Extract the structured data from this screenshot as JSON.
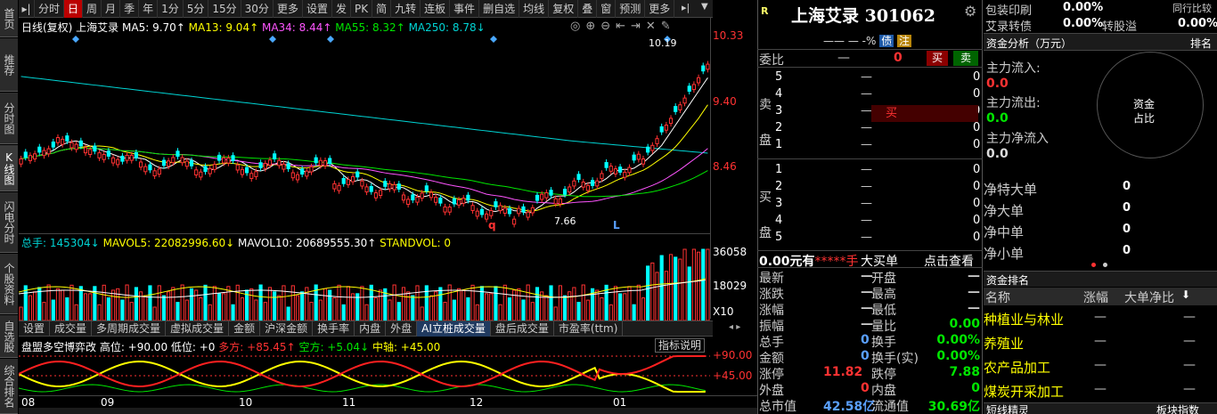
{
  "left_tabs": [
    "首页",
    "推荐",
    "分时图",
    "K线图",
    "闪电分时",
    "个股资料",
    "自选股",
    "综合排名"
  ],
  "toolbar": {
    "items": [
      "分时",
      "日",
      "周",
      "月",
      "季",
      "年",
      "1分",
      "5分",
      "15分",
      "30分",
      "更多",
      "设置",
      "发",
      "PK",
      "简",
      "九转",
      "连板",
      "事件",
      "删自选",
      "均线",
      "复权",
      "叠",
      "窗",
      "预测",
      "更多"
    ],
    "active": "日"
  },
  "chart_info": {
    "prefix": "日线(复权) 上海艾录",
    "ma5": "MA5: 9.70↑",
    "ma13": "MA13: 9.04↑",
    "ma34": "MA34: 8.44↑",
    "ma55": "MA55: 8.32↑",
    "ma250": "MA250: 8.78↓"
  },
  "price_axis": [
    "10.33",
    "9.40",
    "8.46"
  ],
  "annotations": {
    "high": "10.19",
    "low": "7.66",
    "q": "q",
    "l": "L"
  },
  "volume_info": {
    "total": "总手: 145304↓",
    "mavol5": "MAVOL5: 22082996.60↓",
    "mavol10": "MAVOL10: 20689555.30↑",
    "stand": "STANDVOL: 0"
  },
  "volume_axis": [
    "36058",
    "18029",
    "X10"
  ],
  "bottom_tabs": [
    "设置",
    "成交量",
    "多周期成交量",
    "虚拟成交量",
    "金额",
    "沪深金额",
    "换手率",
    "内盘",
    "外盘",
    "AI立桩成交量",
    "盘后成交量",
    "市盈率(ttm)"
  ],
  "bottom_active": "AI立桩成交量",
  "indicator": {
    "title": "盘盟多空博弈改 高位: +90.00 低位: +0",
    "duo": "多方: +85.45↑",
    "kong": "空方: +5.04↓",
    "mid": "中轴: +45.00",
    "help": "指标说明",
    "axis_hi": "+90.00",
    "axis_mid": "+45.00"
  },
  "x_axis": [
    "08",
    "09",
    "10",
    "11",
    "12",
    "01"
  ],
  "quote": {
    "r_badge": "R",
    "title": "上海艾录 301062",
    "sub": "—— — -% ",
    "badge_zhai": "债",
    "badge_zhu": "注",
    "weibi_label": "委比",
    "weibi_val": "—",
    "weibi_num": "0",
    "buy_btn": "买",
    "sell_btn": "卖",
    "sell_label": "卖盘",
    "buy_label": "买盘",
    "sell_levels": [
      {
        "n": "5",
        "p": "—",
        "v": "0"
      },
      {
        "n": "4",
        "p": "—",
        "v": "0"
      },
      {
        "n": "3",
        "p": "—",
        "v": "0"
      },
      {
        "n": "2",
        "p": "—",
        "v": "0"
      },
      {
        "n": "1",
        "p": "—",
        "v": "0"
      }
    ],
    "buy_levels": [
      {
        "n": "1",
        "p": "—",
        "v": "0"
      },
      {
        "n": "2",
        "p": "—",
        "v": "0"
      },
      {
        "n": "3",
        "p": "—",
        "v": "0"
      },
      {
        "n": "4",
        "p": "—",
        "v": "0"
      },
      {
        "n": "5",
        "p": "—",
        "v": "0"
      }
    ],
    "mid_buy_tag": "买",
    "amount_line": "0.00元有",
    "stars": "*****手",
    "big_buy": "大买单",
    "click_view": "点击查看",
    "stats": [
      {
        "l": "最新",
        "v": "—",
        "l2": "开盘",
        "v2": "—"
      },
      {
        "l": "涨跌",
        "v": "—",
        "l2": "最高",
        "v2": "—"
      },
      {
        "l": "涨幅",
        "v": "—",
        "l2": "最低",
        "v2": "—"
      },
      {
        "l": "振幅",
        "v": "—",
        "l2": "量比",
        "v2": "0.00"
      },
      {
        "l": "总手",
        "v": "0",
        "l2": "换手",
        "v2": "0.00%"
      },
      {
        "l": "金额",
        "v": "0",
        "l2": "换手(实)",
        "v2": "0.00%"
      },
      {
        "l": "涨停",
        "v": "11.82",
        "l2": "跌停",
        "v2": "7.88"
      },
      {
        "l": "外盘",
        "v": "0",
        "l2": "内盘",
        "v2": "0"
      },
      {
        "l": "总市值",
        "v": "42.58亿",
        "l2": "流通值",
        "v2": "30.69亿"
      }
    ]
  },
  "far_right": {
    "top_rows": [
      {
        "l": "包装印刷",
        "v": "0.00%",
        "l2": "同行比较",
        "v2": ""
      },
      {
        "l": "艾录转债",
        "v": "0.00%",
        "l2": "转股溢",
        "v2": "0.00%"
      }
    ],
    "fund_title": "资金分析（万元）",
    "fund_rank": "排名",
    "inflow_label": "主力流入:",
    "inflow_val": "0.0",
    "outflow_label": "主力流出:",
    "outflow_val": "0.0",
    "net_label": "主力净流入",
    "net_val": "0.0",
    "circle_text1": "资金",
    "circle_text2": "占比",
    "net_rows": [
      {
        "l": "净特大单",
        "v": "0"
      },
      {
        "l": "净大单",
        "v": "0"
      },
      {
        "l": "净中单",
        "v": "0"
      },
      {
        "l": "净小单",
        "v": "0"
      }
    ],
    "rank_title": "资金排名",
    "rank_headers": [
      "名称",
      "涨幅",
      "大单净比"
    ],
    "rank_rows": [
      {
        "name": "种植业与林业",
        "chg": "—",
        "ratio": "—"
      },
      {
        "name": "养殖业",
        "chg": "—",
        "ratio": "—"
      },
      {
        "name": "农产品加工",
        "chg": "—",
        "ratio": "—"
      },
      {
        "name": "煤炭开采加工",
        "chg": "—",
        "ratio": "—"
      }
    ],
    "bottom_left": "短线精灵",
    "bottom_right": "板块指数"
  }
}
